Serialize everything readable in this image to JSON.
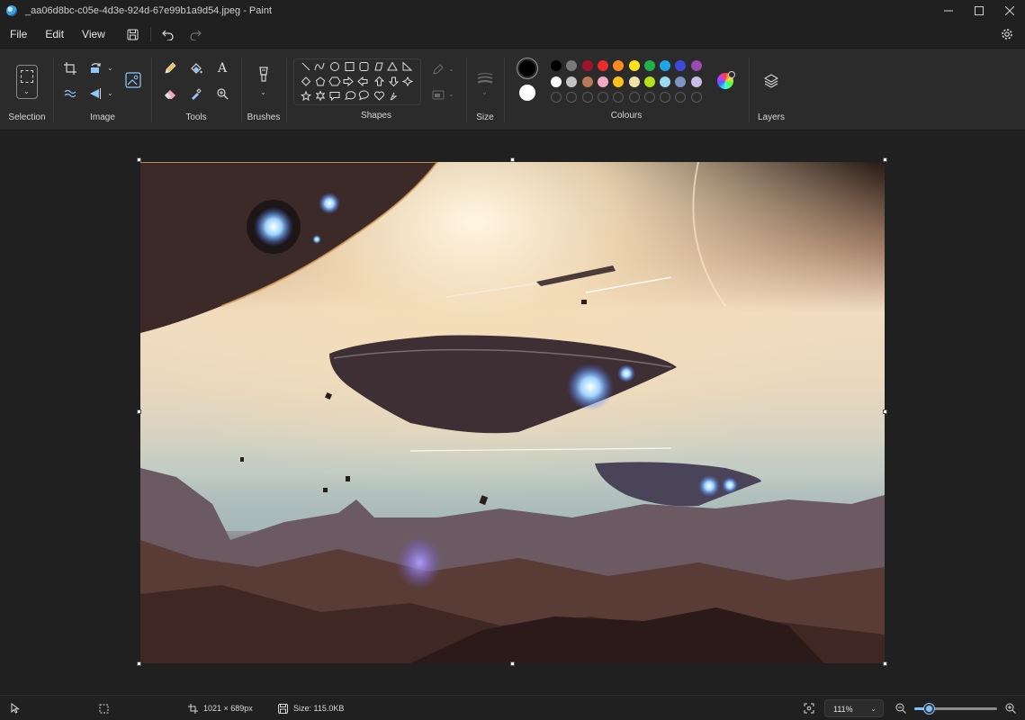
{
  "window": {
    "title": "_aa06d8bc-c05e-4d3e-924d-67e99b1a9d54.jpeg - Paint"
  },
  "menu": {
    "file": "File",
    "edit": "Edit",
    "view": "View"
  },
  "ribbon": {
    "selection": "Selection",
    "image": "Image",
    "tools": "Tools",
    "brushes": "Brushes",
    "shapes": "Shapes",
    "size": "Size",
    "colours": "Colours",
    "layers": "Layers",
    "text_tool_glyph": "A"
  },
  "palette": {
    "current_primary": "#000000",
    "current_secondary": "#ffffff",
    "row1": [
      "#000000",
      "#7a7a7a",
      "#a0142a",
      "#ea2b2b",
      "#ff8a1e",
      "#ffe21a",
      "#21b34a",
      "#1aa6e8",
      "#3f4ad8",
      "#9a4ab0"
    ],
    "row2": [
      "#ffffff",
      "#c3c3c3",
      "#b87a56",
      "#f5a8c4",
      "#ffc21a",
      "#efe2a6",
      "#b6e21a",
      "#9cd8ef",
      "#7f92c4",
      "#c8bde6"
    ]
  },
  "status": {
    "dimensions": "1021 × 689px",
    "size": "Size: 115.0KB",
    "zoom": "111%",
    "zoom_level": 0.18
  }
}
